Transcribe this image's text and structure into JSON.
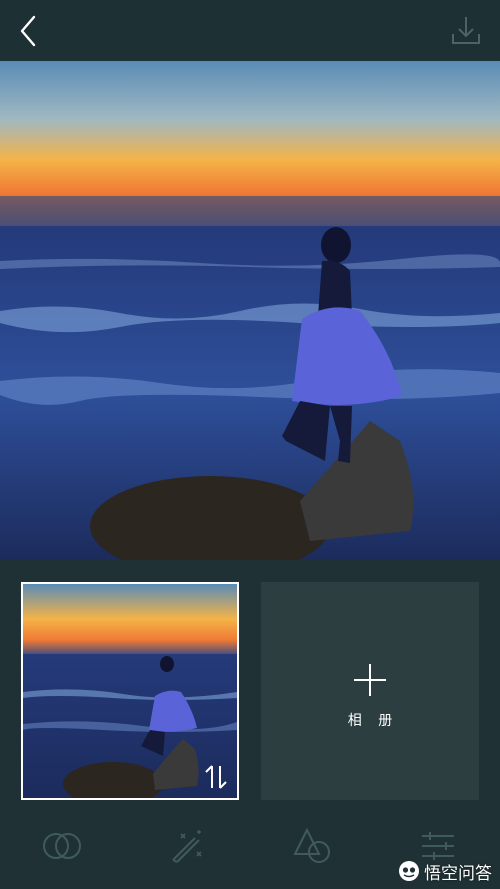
{
  "header": {
    "back_icon": "chevron-left-icon",
    "download_icon": "download-icon"
  },
  "photo": {
    "description_colors": {
      "sky_top": "#5d8fb8",
      "horizon": "#f39a3a",
      "sea": "#2a3f7a"
    }
  },
  "panel": {
    "thumbnail": {
      "swap_icon": "swap-vertical-icon"
    },
    "album": {
      "icon": "plus-icon",
      "label": "相 册"
    }
  },
  "toolbar": {
    "tools": [
      {
        "icon": "overlap-circles-icon"
      },
      {
        "icon": "magic-wand-icon"
      },
      {
        "icon": "shapes-icon"
      },
      {
        "icon": "sliders-icon"
      }
    ]
  },
  "watermark": {
    "text": "悟空问答"
  },
  "colors": {
    "background": "#1f3134",
    "album_tile": "#2c3e40",
    "icon_dim": "#3f5b5d",
    "icon_light": "#ffffff"
  }
}
